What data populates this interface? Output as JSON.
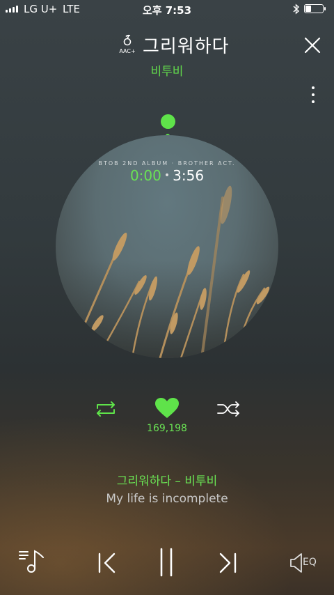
{
  "status_bar": {
    "carrier": "LG U+",
    "network": "LTE",
    "time": "오후 7:53",
    "bluetooth_icon": "bluetooth-icon",
    "battery_icon": "battery-icon"
  },
  "header": {
    "quality_icon": "aac-plus-icon",
    "quality_label": "AAC+",
    "title": "그리워하다",
    "artist": "비투비",
    "close_icon": "close-icon",
    "more_icon": "more-vertical-icon"
  },
  "player": {
    "album_label": "BTOB 2ND ALBUM · BROTHER ACT.",
    "current_time": "0:00",
    "separator": "•",
    "total_time": "3:56",
    "progress": 0.0
  },
  "actions": {
    "repeat_icon": "repeat-icon",
    "like_icon": "heart-icon",
    "like_count": "169,198",
    "shuffle_icon": "shuffle-icon"
  },
  "lyrics": {
    "song_line": "그리워하다 – 비투비",
    "current_lyric": "My life is incomplete"
  },
  "controls": {
    "playlist_icon": "playlist-icon",
    "prev_icon": "previous-icon",
    "pause_icon": "pause-icon",
    "next_icon": "next-icon",
    "eq_icon": "equalizer-icon",
    "eq_label": "EQ"
  },
  "colors": {
    "accent": "#5fe34a",
    "background": "#323a3d"
  }
}
